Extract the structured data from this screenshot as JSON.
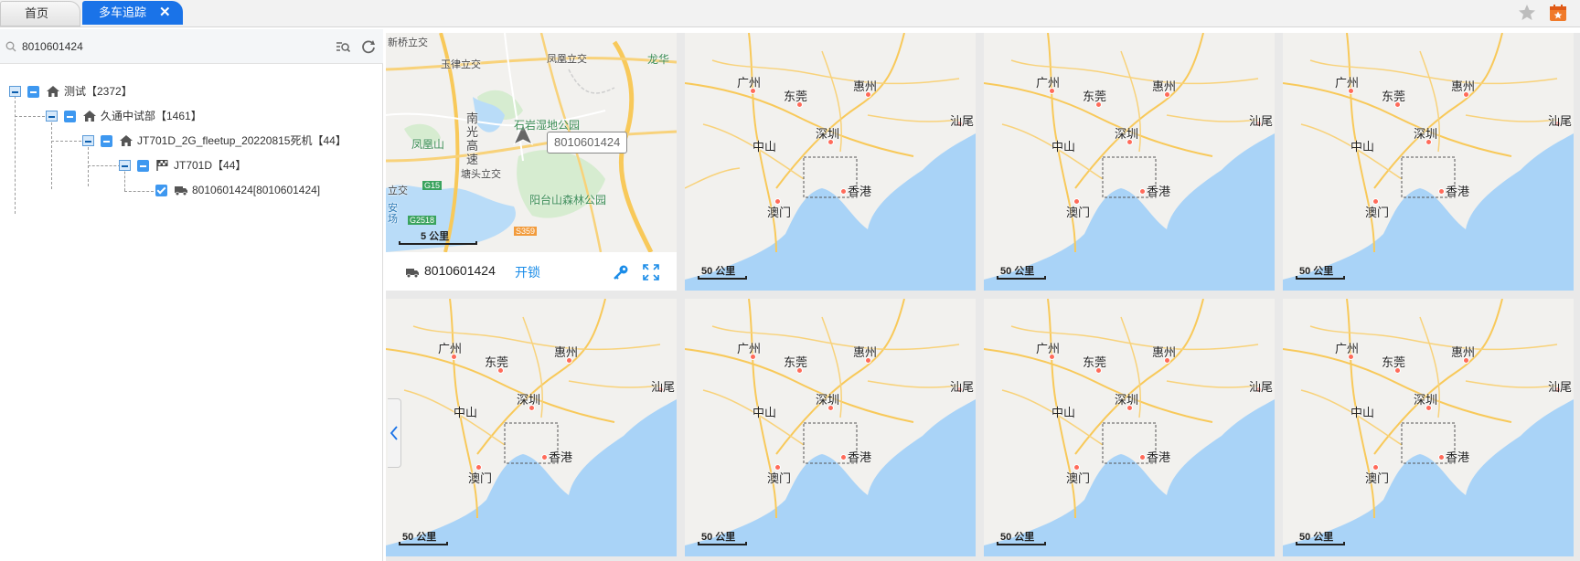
{
  "tabs": [
    {
      "label": "首页",
      "active": false
    },
    {
      "label": "多车追踪",
      "active": true
    }
  ],
  "sidebar": {
    "search_value": "8010601424",
    "tree": [
      {
        "label": "测试【2372】",
        "icon": "home-icon",
        "level": 0
      },
      {
        "label": "久通中试部【1461】",
        "icon": "home-icon",
        "level": 1
      },
      {
        "label": "JT701D_2G_fleetup_20220815死机【44】",
        "icon": "home-icon",
        "level": 2
      },
      {
        "label": "JT701D【44】",
        "icon": "flag-icon",
        "level": 3
      },
      {
        "label": "8010601424[8010601424]",
        "icon": "truck-icon",
        "level": 4
      }
    ]
  },
  "detail_map": {
    "marker_label": "8010601424",
    "plate": "8010601424",
    "unlock_label": "开锁",
    "scale_label": "5 公里",
    "labels": {
      "a": "新桥立交",
      "b": "玉律立交",
      "c": "凤凰立交",
      "d": "龙华",
      "e": "石岩湿地公园",
      "f": "凤凰山",
      "g": "南光高速",
      "h": "塘头立交",
      "i": "阳台山森林公园",
      "j": "立交",
      "k": "安场",
      "l": "G15",
      "m": "G2518",
      "n": "S359"
    }
  },
  "overview_map": {
    "scale_label": "50 公里",
    "cities": {
      "guangzhou": "广州",
      "dongguan": "东莞",
      "huizhou": "惠州",
      "shenzhen": "深圳",
      "shanwei": "汕尾",
      "zhongshan": "中山",
      "hongkong": "香港",
      "macau": "澳门"
    }
  },
  "colors": {
    "tab_active": "#1a73e8",
    "checkbox": "#3e98f0",
    "sea": "#a9d3f7",
    "land": "#f2f1ee",
    "road": "#f8c95a",
    "link": "#1a8ce8"
  }
}
